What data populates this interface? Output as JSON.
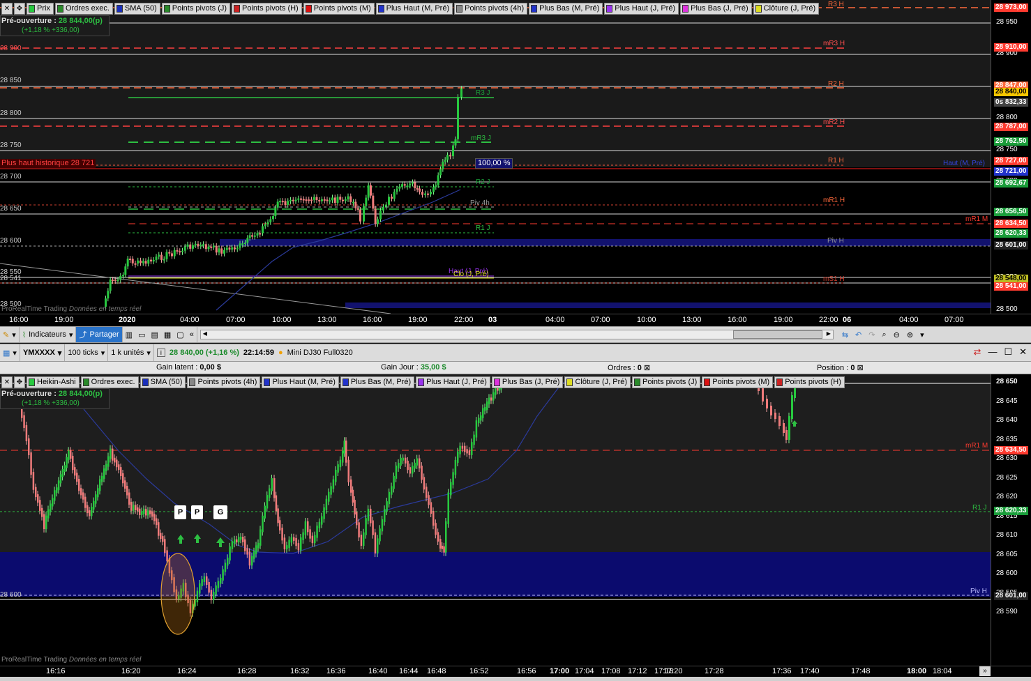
{
  "colors": {
    "up": "#27c93f",
    "down": "#f07b7b",
    "pivot": "#ff3333",
    "r_orange": "#ff6a3c",
    "green_level": "#2dbf42",
    "blue_band": "#0b0b6e",
    "sma": "#2b3a9a"
  },
  "top_legend": [
    {
      "label": "Prix",
      "color": "#27c93f"
    },
    {
      "label": "Ordres exec.",
      "color": "#2a8a2a"
    },
    {
      "label": "SMA (50)",
      "color": "#1a2fbb"
    },
    {
      "label": "Points pivots (J)",
      "color": "#2a8a2a"
    },
    {
      "label": "Points pivots (H)",
      "color": "#cc2222"
    },
    {
      "label": "Points pivots (M)",
      "color": "#dd1111"
    },
    {
      "label": "Plus Haut (M, Pré)",
      "color": "#2233cc"
    },
    {
      "label": "Points pivots (4h)",
      "color": "#888888"
    },
    {
      "label": "Plus Bas (M, Pré)",
      "color": "#2233cc"
    },
    {
      "label": "Plus Haut (J, Pré)",
      "color": "#9933ee"
    },
    {
      "label": "Plus Bas (J, Pré)",
      "color": "#dd33dd"
    },
    {
      "label": "Clôture (J, Pré)",
      "color": "#dddd22"
    }
  ],
  "top_info": {
    "preopen_label": "Pré-ouverture :",
    "preopen_value": "28 844,00(p)",
    "change": "(+1,18 % +336,00)"
  },
  "top_axis": {
    "ticks": [
      "28 950",
      "28 900",
      "28 850",
      "28 800",
      "28 750",
      "28 700",
      "28 650",
      "28 600",
      "28 550",
      "28 500"
    ],
    "tags": [
      {
        "text": "28 973,00",
        "bg": "#ff3b30"
      },
      {
        "text": "28 910,00",
        "bg": "#ff3b30"
      },
      {
        "text": "28 847,00",
        "bg": "#ff6a3c"
      },
      {
        "text": "28 840,00",
        "bg": "#f7c600",
        "fg": "#000"
      },
      {
        "text": "0s 832,33",
        "bg": "#444"
      },
      {
        "text": "28 787,00",
        "bg": "#ff3b30"
      },
      {
        "text": "28 762,50",
        "bg": "#1a9d3a"
      },
      {
        "text": "28 727,00",
        "bg": "#ff3b30"
      },
      {
        "text": "28 721,00",
        "bg": "#2233cc"
      },
      {
        "text": "28 692,67",
        "bg": "#1a9d3a"
      },
      {
        "text": "28 656,50",
        "bg": "#1a9d3a"
      },
      {
        "text": "28 634,50",
        "bg": "#ff3b30"
      },
      {
        "text": "28 620,33",
        "bg": "#1a9d3a"
      },
      {
        "text": "28 601,00",
        "bg": "#222"
      },
      {
        "text": "28 548,00",
        "bg": "#bbbb22",
        "fg": "#000"
      },
      {
        "text": "28 541,00",
        "bg": "#ff3b30"
      }
    ]
  },
  "top_levels": {
    "r3h": "R3 H",
    "mr3h": "mR3 H",
    "r2h": "R2 H",
    "mr2h": "mR2 H",
    "r1h": "R1 H",
    "mr1h": "mR1 H",
    "pivh": "Piv H",
    "ms1h": "mS1 H",
    "r3j": "R3 J",
    "mr3j": "mR3 J",
    "r2j": "R2 J",
    "piv4h": "Piv 4h",
    "r1j": "R1 J",
    "mr1m": "mR1 M",
    "haut_m": "Haut (M, Pré)",
    "haut_j": "Haut (J, Pré)",
    "clo_j": "Clo (J, Pré)",
    "hist_high": "Plus haut historique 28 721",
    "pct": "100,00 %"
  },
  "top_y_left": [
    "28 850",
    "28 800",
    "28 750",
    "28 700",
    "28 650",
    "28 600",
    "28 550",
    "28 541",
    "28 500"
  ],
  "top_x_labels": [
    "16:00",
    "19:00",
    "2020",
    "04:00",
    "07:00",
    "10:00",
    "13:00",
    "16:00",
    "19:00",
    "22:00",
    "03",
    "04:00",
    "07:00",
    "10:00",
    "13:00",
    "16:00",
    "19:00",
    "22:00",
    "06",
    "04:00",
    "07:00"
  ],
  "watermark": {
    "brand": "ProRealTime Trading",
    "sub": "Données en temps réel"
  },
  "toolbar1": {
    "indicators": "Indicateurs",
    "share": "Partager"
  },
  "toolbar2": {
    "symbol": "YMXXXX",
    "ticks": "100 ticks",
    "units": "1 k unités",
    "price": "28 840,00 (+1,16 %)",
    "time": "22:14:59",
    "instrument": "Mini DJ30 Full0320"
  },
  "status": {
    "gain_latent_label": "Gain latent :",
    "gain_latent": "0,00 $",
    "gain_jour_label": "Gain Jour :",
    "gain_jour": "35,00 $",
    "orders_label": "Ordres :",
    "orders": "0",
    "position_label": "Position :",
    "position": "0"
  },
  "bottom_legend": [
    {
      "label": "Heikin-Ashi",
      "color": "#27c93f"
    },
    {
      "label": "Ordres exec.",
      "color": "#2a8a2a"
    },
    {
      "label": "SMA (50)",
      "color": "#1a2fbb"
    },
    {
      "label": "Points pivots (4h)",
      "color": "#888888"
    },
    {
      "label": "Plus Haut (M, Pré)",
      "color": "#2233cc"
    },
    {
      "label": "Plus Bas (M, Pré)",
      "color": "#2233cc"
    },
    {
      "label": "Plus Haut (J, Pré)",
      "color": "#9933ee"
    },
    {
      "label": "Plus Bas (J, Pré)",
      "color": "#dd33dd"
    },
    {
      "label": "Clôture (J, Pré)",
      "color": "#dddd22"
    },
    {
      "label": "Points pivots (J)",
      "color": "#2a8a2a"
    },
    {
      "label": "Points pivots (M)",
      "color": "#dd1111"
    },
    {
      "label": "Points pivots (H)",
      "color": "#cc2222"
    }
  ],
  "bottom_axis": {
    "ticks": [
      "28 650",
      "28 645",
      "28 640",
      "28 635",
      "28 630",
      "28 625",
      "28 620",
      "28 615",
      "28 610",
      "28 605",
      "28 600",
      "28 595",
      "28 590"
    ],
    "tags": [
      {
        "text": "28 634,50",
        "bg": "#ff3b30"
      },
      {
        "text": "28 620,33",
        "bg": "#1a9d3a"
      },
      {
        "text": "28 601,00",
        "bg": "#222"
      }
    ]
  },
  "bottom_levels": {
    "mr1m": "mR1 M",
    "r1j": "R1 J",
    "pivh": "Piv H",
    "left600": "28 600"
  },
  "markers": [
    "P",
    "P",
    "G"
  ],
  "bottom_x_labels": [
    "16:16",
    "16:20",
    "16:24",
    "16:28",
    "16:32",
    "16:36",
    "16:40",
    "16:44",
    "16:48",
    "16:52",
    "16:56",
    "17:00",
    "17:04",
    "17:08",
    "17:12",
    "17:16",
    "17:20",
    "17:28",
    "17:36",
    "17:40",
    "17:48",
    "18:00",
    "18:04"
  ]
}
